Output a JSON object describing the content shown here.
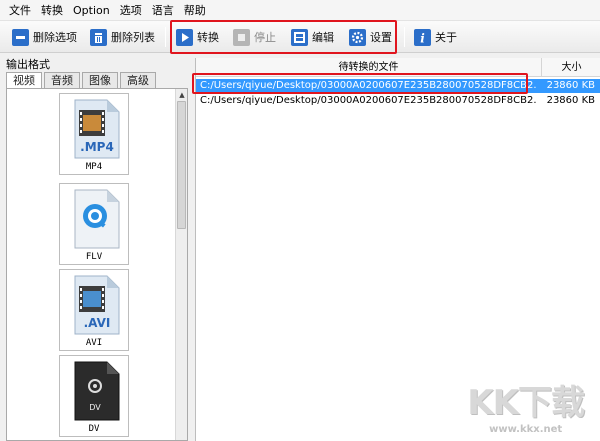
{
  "menubar": {
    "items": [
      "文件",
      "转换",
      "Option",
      "选项",
      "语言",
      "帮助"
    ]
  },
  "toolbar": {
    "delete_item_label": "删除选项",
    "delete_list_label": "删除列表",
    "convert_label": "转换",
    "stop_label": "停止",
    "edit_label": "编辑",
    "settings_label": "设置",
    "about_label": "关于"
  },
  "left": {
    "title": "输出格式",
    "tabs": [
      "视频",
      "音频",
      "图像",
      "高级"
    ],
    "formats": [
      {
        "icon_text": ".MP4",
        "label": "MP4",
        "icon": "mp4-file-icon"
      },
      {
        "icon_text": "",
        "label": "FLV",
        "icon": "flv-file-icon"
      },
      {
        "icon_text": ".AVI",
        "label": "AVI",
        "icon": "avi-file-icon"
      },
      {
        "icon_text": "DV",
        "label": "DV",
        "icon": "dv-file-icon"
      }
    ]
  },
  "list": {
    "col_file": "待转换的文件",
    "col_size": "大小",
    "rows": [
      {
        "file": "C:/Users/qiyue/Desktop/03000A0200607E235B280070528DF8CB2...",
        "size": "23860 KB",
        "selected": true
      },
      {
        "file": "C:/Users/qiyue/Desktop/03000A0200607E235B280070528DF8CB2...",
        "size": "23860 KB",
        "selected": false
      }
    ]
  },
  "watermark": {
    "big": "KK下载",
    "small": "www.kkx.net"
  },
  "colors": {
    "highlight_border": "#e0151e",
    "selection": "#3399ff"
  }
}
